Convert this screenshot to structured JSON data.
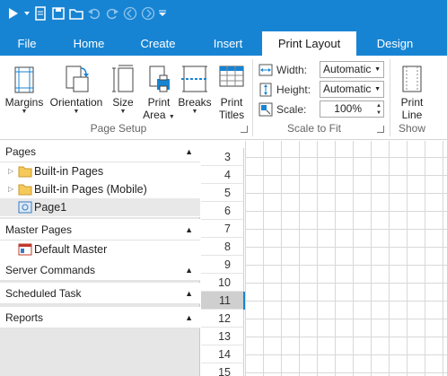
{
  "ribbon_tabs": [
    "File",
    "Home",
    "Create",
    "Insert",
    "Print Layout",
    "Design"
  ],
  "active_tab": "Print Layout",
  "page_setup": {
    "margins": "Margins",
    "orientation": "Orientation",
    "size": "Size",
    "print_area_1": "Print",
    "print_area_2": "Area",
    "breaks": "Breaks",
    "print_titles_1": "Print",
    "print_titles_2": "Titles",
    "group_label": "Page Setup"
  },
  "scale_to_fit": {
    "width_label": "Width:",
    "width_value": "Automatic",
    "height_label": "Height:",
    "height_value": "Automatic",
    "scale_label": "Scale:",
    "scale_value": "100%",
    "group_label": "Scale to Fit"
  },
  "show": {
    "print_line_1": "Print",
    "print_line_2": "Line",
    "group_label": "Show"
  },
  "panel": {
    "pages_header": "Pages",
    "pages_items": [
      "Built-in Pages",
      "Built-in Pages (Mobile)",
      "Page1"
    ],
    "master_header": "Master Pages",
    "master_items": [
      "Default Master"
    ],
    "server_header": "Server Commands",
    "scheduled_header": "Scheduled Task",
    "reports_header": "Reports"
  },
  "grid_rows": [
    "3",
    "4",
    "5",
    "6",
    "7",
    "8",
    "9",
    "10",
    "11",
    "12",
    "13",
    "14",
    "15"
  ],
  "current_row": "11",
  "colors": {
    "accent": "#1784d3",
    "selected_row": "#cfcfcf"
  }
}
